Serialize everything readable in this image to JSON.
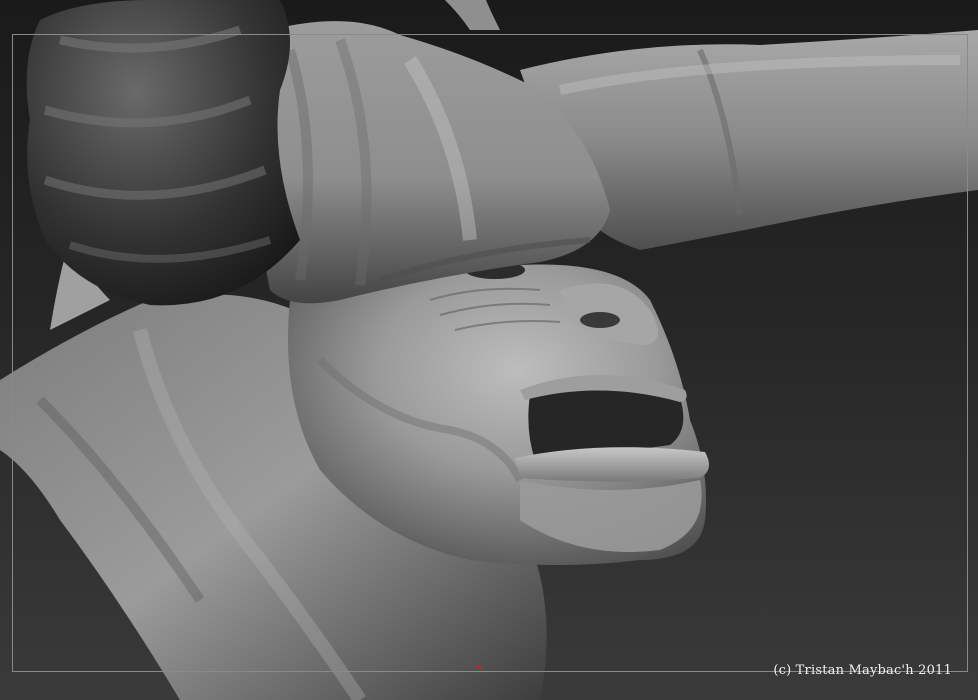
{
  "viewport": {
    "background_top": "#1a1a1a",
    "background_bottom": "#3a3a3a",
    "frame_color": "#8a8a8a",
    "marker_color": "#d02020"
  },
  "sculpt": {
    "material_color": "#8c8c8c",
    "subject": "horned-creature-head-sculpt"
  },
  "watermark": {
    "text": "(c) Tristan Maybac'h 2011",
    "color": "#f0f0f0"
  }
}
